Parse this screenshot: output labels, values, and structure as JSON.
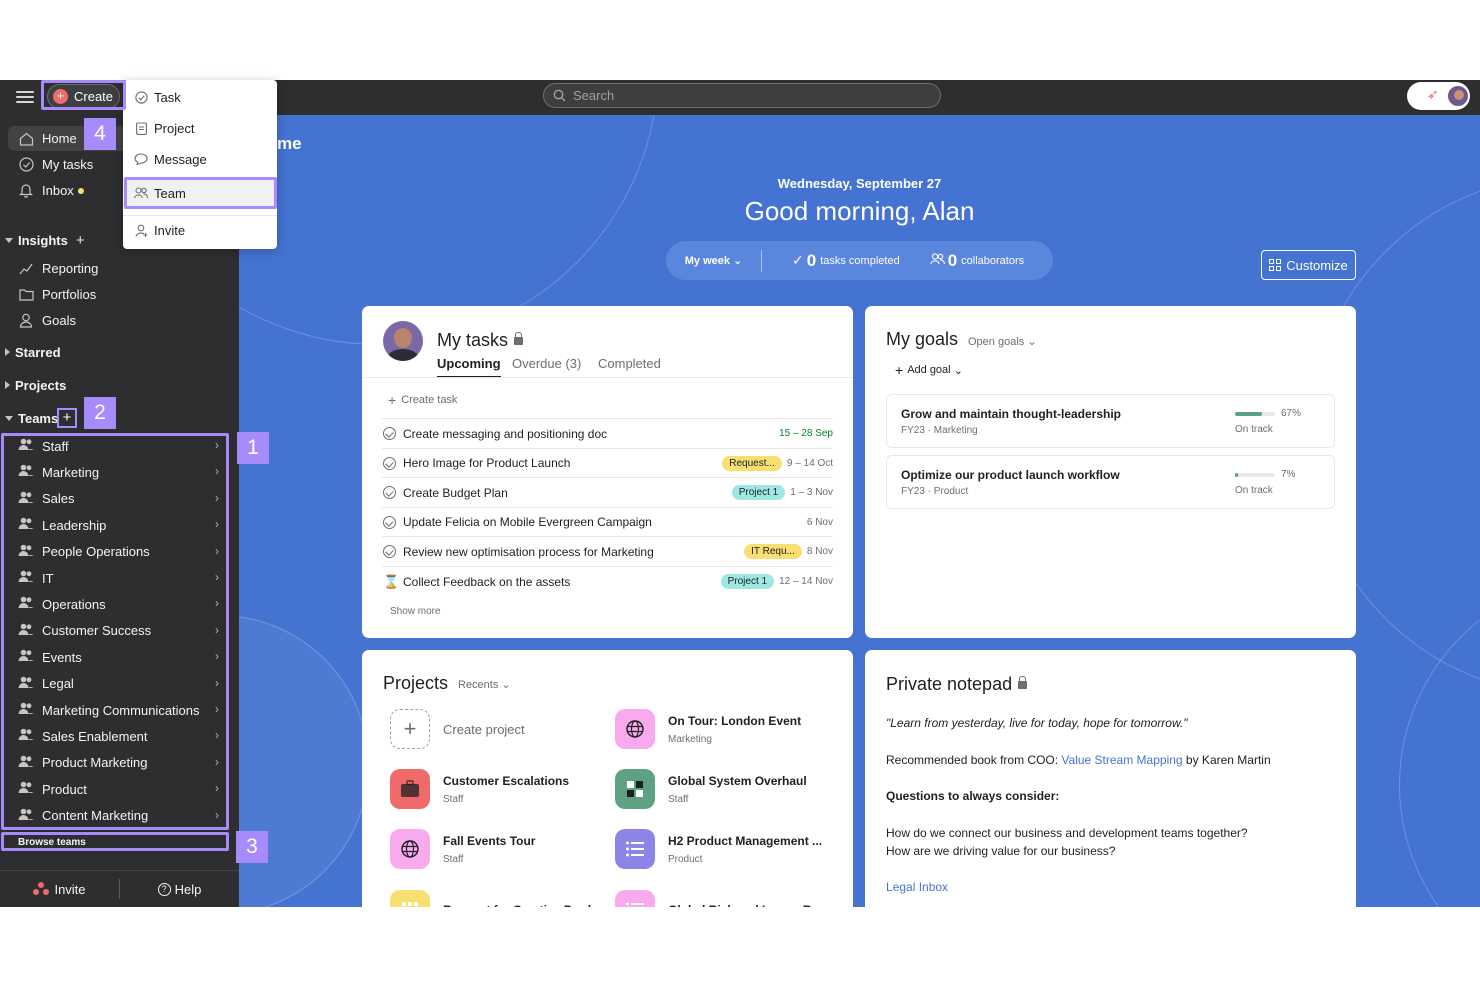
{
  "topbar": {
    "create_label": "Create",
    "search_placeholder": "Search"
  },
  "create_menu": {
    "items": [
      {
        "label": "Task",
        "icon": "check-circle-icon"
      },
      {
        "label": "Project",
        "icon": "clipboard-icon"
      },
      {
        "label": "Message",
        "icon": "chat-bubble-icon"
      },
      {
        "label": "Team",
        "icon": "people-icon"
      },
      {
        "label": "Invite",
        "icon": "person-add-icon"
      }
    ],
    "selected": "Team"
  },
  "sidebar": {
    "nav": [
      {
        "label": "Home",
        "icon": "home-icon"
      },
      {
        "label": "My tasks",
        "icon": "check-circle-icon"
      },
      {
        "label": "Inbox",
        "icon": "bell-icon"
      }
    ],
    "insights_label": "Insights",
    "insights_items": [
      {
        "label": "Reporting",
        "icon": "trend-line-icon"
      },
      {
        "label": "Portfolios",
        "icon": "folder-icon"
      },
      {
        "label": "Goals",
        "icon": "person-goal-icon"
      }
    ],
    "starred_label": "Starred",
    "projects_label": "Projects",
    "teams_label": "Teams",
    "teams": [
      "Staff",
      "Marketing",
      "Sales",
      "Leadership",
      "People Operations",
      "IT",
      "Operations",
      "Customer Success",
      "Events",
      "Legal",
      "Marketing Communications",
      "Sales Enablement",
      "Product Marketing",
      "Product",
      "Content Marketing"
    ],
    "browse_teams": "Browse teams",
    "footer": {
      "invite": "Invite",
      "help": "Help"
    }
  },
  "annotations": {
    "one": "1",
    "two": "2",
    "three": "3",
    "four": "4"
  },
  "home": {
    "title_fragment": "me",
    "date": "Wednesday, September 27",
    "greeting": "Good morning, Alan",
    "period": "My week",
    "tasks_completed_count": "0",
    "tasks_completed_label": "tasks completed",
    "collaborators_count": "0",
    "collaborators_label": "collaborators",
    "customize": "Customize"
  },
  "my_tasks": {
    "title": "My tasks",
    "tabs": [
      "Upcoming",
      "Overdue (3)",
      "Completed"
    ],
    "create_task": "Create task",
    "rows": [
      {
        "name": "Create messaging and positioning doc",
        "tag": "",
        "due": "15 – 28 Sep",
        "icon": "check"
      },
      {
        "name": "Hero Image for Product Launch",
        "tag": "Request...",
        "due": "9 – 14 Oct",
        "icon": "check"
      },
      {
        "name": "Create Budget Plan",
        "tag": "Project 1",
        "due": "1 – 3 Nov",
        "icon": "check"
      },
      {
        "name": "Update Felicia on Mobile Evergreen Campaign",
        "tag": "",
        "due": "6 Nov",
        "icon": "check"
      },
      {
        "name": "Review new optimisation process for Marketing",
        "tag": "IT Requ...",
        "due": "8 Nov",
        "icon": "check"
      },
      {
        "name": "Collect Feedback on the assets",
        "tag": "Project 1",
        "due": "12 – 14 Nov",
        "icon": "hourglass"
      }
    ],
    "show_more": "Show more",
    "colors": {
      "tag_yellow": "#f8df72",
      "tag_teal": "#9ee7e3",
      "due_green": "#058527"
    }
  },
  "my_goals": {
    "title": "My goals",
    "filter": "Open goals",
    "add_goal": "Add goal",
    "goals": [
      {
        "name": "Grow and maintain thought-leadership",
        "period": "FY23",
        "team": "Marketing",
        "progress": 0.67,
        "pct": "67%",
        "status": "On track"
      },
      {
        "name": "Optimize our product launch workflow",
        "period": "FY23",
        "team": "Product",
        "progress": 0.07,
        "pct": "7%",
        "status": "On track"
      }
    ]
  },
  "projects": {
    "title": "Projects",
    "filter": "Recents",
    "create": "Create project",
    "items": [
      {
        "name": "On Tour: London Event",
        "team": "Marketing",
        "icon": "globe-icon",
        "color": "#f9aaef"
      },
      {
        "name": "Customer Escalations",
        "team": "Staff",
        "icon": "briefcase-icon",
        "color": "#f06a6a"
      },
      {
        "name": "Global System Overhaul",
        "team": "Staff",
        "icon": "puzzle-icon",
        "color": "#5da283"
      },
      {
        "name": "Fall Events Tour",
        "team": "Staff",
        "icon": "globe-icon",
        "color": "#f9aaef"
      },
      {
        "name": "H2 Product Management ...",
        "team": "Product",
        "icon": "list-icon",
        "color": "#8d84e8"
      },
      {
        "name": "Request for Creative Prod...",
        "team": "",
        "icon": "grid-icon",
        "color": "#f8df72"
      },
      {
        "name": "Global Risk and Issues Re...",
        "team": "",
        "icon": "list-icon",
        "color": "#f9aaef"
      }
    ]
  },
  "notepad": {
    "title": "Private notepad",
    "quote": "\"Learn from yesterday, live for today, hope for tomorrow.\"",
    "rec_prefix": "Recommended book from COO: ",
    "rec_link": "Value Stream Mapping",
    "rec_suffix": " by Karen Martin",
    "questions_heading": "Questions to always consider:",
    "q1": "How do we connect our business and development teams together?",
    "q2": "How are we driving value for our business?",
    "link": "Legal Inbox"
  },
  "theme": {
    "accent": "#4573d2",
    "sidebar": "#2e2e30",
    "highlight": "#a78bfa",
    "create_plus": "#f06a6a"
  }
}
